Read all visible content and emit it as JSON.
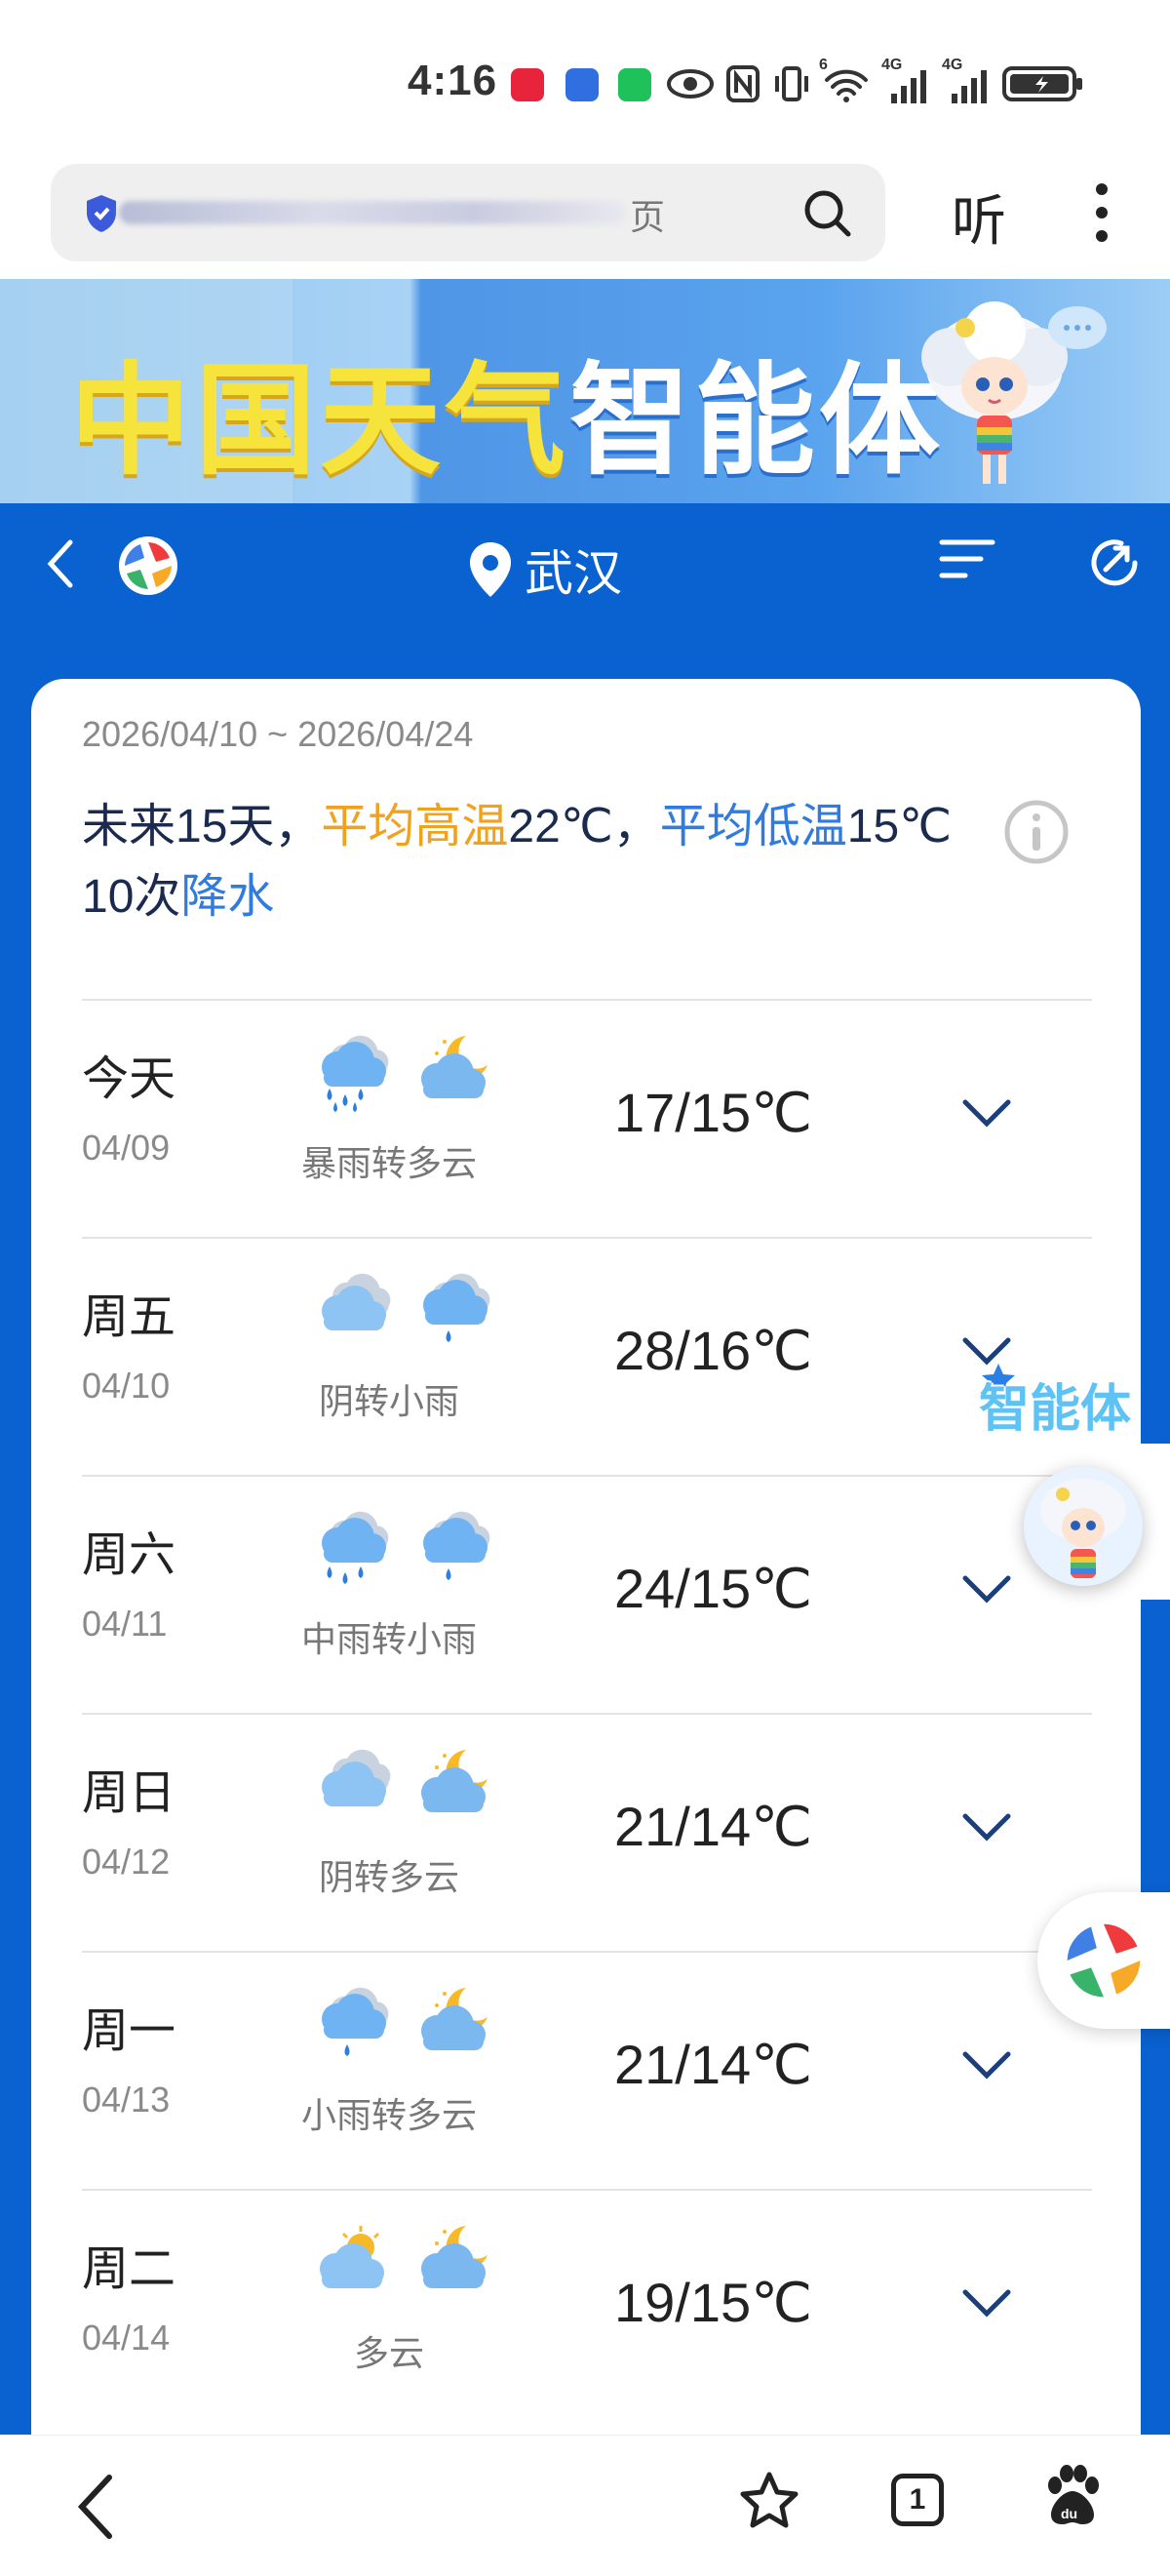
{
  "status_bar": {
    "time": "4:16",
    "network_a": "4G",
    "network_b": "4G",
    "wifi_badge": "6"
  },
  "browser": {
    "url_fragment": "页",
    "listen_label": "听"
  },
  "banner": {
    "title_part1": "中国天气",
    "title_part2": "智能体"
  },
  "header": {
    "city": "武汉"
  },
  "forecast": {
    "date_range": "2026/04/10 ~ 2026/04/24",
    "summary": {
      "prefix": "未来15天，",
      "high_label": "平均高温",
      "high_value": "22℃，",
      "low_label": "平均低温",
      "low_value": "15℃",
      "rain_count": "10次",
      "rain_label": "降水"
    },
    "days": [
      {
        "day": "今天",
        "date": "04/09",
        "desc": "暴雨转多云",
        "temp": "17/15℃",
        "icon_a": "heavy-rain-icon",
        "icon_b": "night-cloudy-icon"
      },
      {
        "day": "周五",
        "date": "04/10",
        "desc": "阴转小雨",
        "temp": "28/16℃",
        "icon_a": "overcast-icon",
        "icon_b": "light-rain-icon"
      },
      {
        "day": "周六",
        "date": "04/11",
        "desc": "中雨转小雨",
        "temp": "24/15℃",
        "icon_a": "moderate-rain-icon",
        "icon_b": "light-rain-icon"
      },
      {
        "day": "周日",
        "date": "04/12",
        "desc": "阴转多云",
        "temp": "21/14℃",
        "icon_a": "overcast-icon",
        "icon_b": "night-cloudy-icon"
      },
      {
        "day": "周一",
        "date": "04/13",
        "desc": "小雨转多云",
        "temp": "21/14℃",
        "icon_a": "light-rain-icon",
        "icon_b": "night-cloudy-icon"
      },
      {
        "day": "周二",
        "date": "04/14",
        "desc": "多云",
        "temp": "19/15℃",
        "icon_a": "day-cloudy-icon",
        "icon_b": "night-cloudy-icon"
      }
    ]
  },
  "floating": {
    "ai_label": "智能体"
  },
  "bottom_nav": {
    "tab_count": "1"
  },
  "colors": {
    "header_blue": "#0a62d1",
    "orange": "#f0a21e",
    "accent_blue": "#2f7be0"
  }
}
